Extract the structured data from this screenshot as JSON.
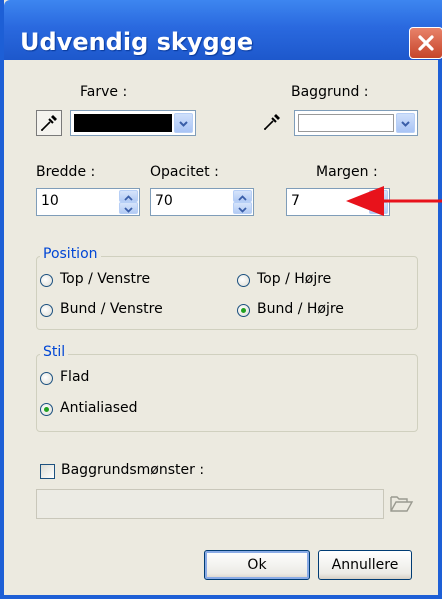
{
  "window": {
    "title": "Udvendig skygge",
    "close_icon": "close-icon"
  },
  "colors": {
    "title_bar": "#2a69df",
    "dialog_bg": "#eceae0",
    "group_label": "#0046d5",
    "arrow": "#e8121b",
    "color_swatch": "#000000",
    "background_swatch": "#ffffff"
  },
  "color": {
    "label": "Farve :",
    "dropper_icon": "eyedropper-icon",
    "value_color": "#000000"
  },
  "background": {
    "label": "Baggrund :",
    "dropper_icon": "eyedropper-icon",
    "value_color": "#ffffff"
  },
  "width": {
    "label": "Bredde :",
    "value": "10"
  },
  "opacity": {
    "label": "Opacitet :",
    "value": "70"
  },
  "margin": {
    "label": "Margen :",
    "value": "7"
  },
  "position": {
    "label": "Position",
    "options": [
      {
        "label": "Top / Venstre",
        "selected": false
      },
      {
        "label": "Top / Højre",
        "selected": false
      },
      {
        "label": "Bund / Venstre",
        "selected": false
      },
      {
        "label": "Bund / Højre",
        "selected": true
      }
    ]
  },
  "style": {
    "label": "Stil",
    "options": [
      {
        "label": "Flad",
        "selected": false
      },
      {
        "label": "Antialiased",
        "selected": true
      }
    ]
  },
  "pattern": {
    "label": "Baggrundsmønster :",
    "checked": false,
    "path_value": "",
    "browse_icon": "folder-open-icon"
  },
  "buttons": {
    "ok": "Ok",
    "cancel": "Annullere"
  }
}
